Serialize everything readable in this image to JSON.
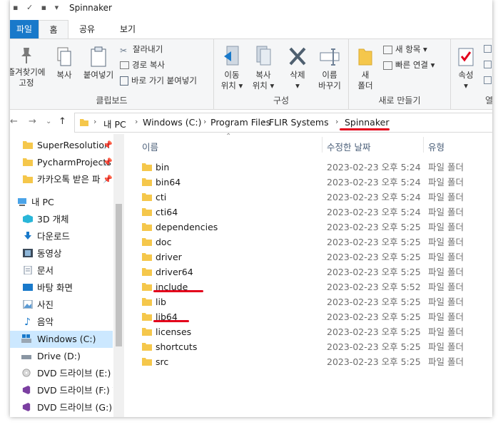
{
  "window": {
    "title": "Spinnaker"
  },
  "tabs": [
    "파일",
    "홈",
    "공유",
    "보기"
  ],
  "ribbon": {
    "clipboard": {
      "pin_label": [
        "즐겨찾기에",
        "고정"
      ],
      "copy_label": "복사",
      "paste_label": "붙여넣기",
      "cut_label": "잘라내기",
      "copy_path_label": "경로 복사",
      "paste_shortcut_label": "바로 가기 붙여넣기",
      "group_label": "클립보드"
    },
    "organize": {
      "move_label": [
        "이동",
        "위치 ▾"
      ],
      "copyto_label": [
        "복사",
        "위치 ▾"
      ],
      "delete_label": [
        "삭제",
        "▾"
      ],
      "rename_label": [
        "이름",
        "바꾸기"
      ],
      "group_label": "구성"
    },
    "new": {
      "new_folder_label": [
        "새",
        "폴더"
      ],
      "new_item_label": "새 항목 ▾",
      "easy_access_label": "빠른 연결 ▾",
      "group_label": "새로 만들기"
    },
    "open": {
      "properties_label": [
        "속성",
        "▾"
      ],
      "group_label_partial": "열"
    }
  },
  "address": {
    "crumbs": [
      "내 PC",
      "Windows (C:)",
      "Program Files",
      "FLIR Systems",
      "Spinnaker"
    ]
  },
  "sidebar": {
    "items": [
      {
        "label": "SuperResolution",
        "icon": "folder-icon",
        "pinned": true
      },
      {
        "label": "PycharmProjects",
        "icon": "folder-icon",
        "pinned": true
      },
      {
        "label": "카카오톡 받은 파",
        "icon": "folder-icon",
        "pinned": true
      },
      {
        "label": "내 PC",
        "icon": "pc-icon"
      },
      {
        "label": "3D 개체",
        "icon": "3d-objects-icon"
      },
      {
        "label": "다운로드",
        "icon": "download-icon"
      },
      {
        "label": "동영상",
        "icon": "video-icon"
      },
      {
        "label": "문서",
        "icon": "document-icon"
      },
      {
        "label": "바탕 화면",
        "icon": "desktop-icon"
      },
      {
        "label": "사진",
        "icon": "pictures-icon"
      },
      {
        "label": "음악",
        "icon": "music-icon"
      },
      {
        "label": "Windows (C:)",
        "icon": "drive-c-icon",
        "selected": true
      },
      {
        "label": "Drive (D:)",
        "icon": "drive-icon"
      },
      {
        "label": "DVD 드라이브 (E:) V",
        "icon": "dvd-icon"
      },
      {
        "label": "DVD 드라이브 (F:) V",
        "icon": "vs-dvd-icon"
      },
      {
        "label": "DVD 드라이브 (G:) V",
        "icon": "vs-dvd-icon"
      }
    ]
  },
  "columns": {
    "name": "이름",
    "date": "수정한 날짜",
    "type": "유형"
  },
  "files": [
    {
      "name": "bin",
      "date": "2023-02-23 오후 5:24",
      "type": "파일 폴더"
    },
    {
      "name": "bin64",
      "date": "2023-02-23 오후 5:24",
      "type": "파일 폴더"
    },
    {
      "name": "cti",
      "date": "2023-02-23 오후 5:24",
      "type": "파일 폴더"
    },
    {
      "name": "cti64",
      "date": "2023-02-23 오후 5:24",
      "type": "파일 폴더"
    },
    {
      "name": "dependencies",
      "date": "2023-02-23 오후 5:25",
      "type": "파일 폴더"
    },
    {
      "name": "doc",
      "date": "2023-02-23 오후 5:25",
      "type": "파일 폴더"
    },
    {
      "name": "driver",
      "date": "2023-02-23 오후 5:25",
      "type": "파일 폴더"
    },
    {
      "name": "driver64",
      "date": "2023-02-23 오후 5:25",
      "type": "파일 폴더"
    },
    {
      "name": "include",
      "date": "2023-02-23 오후 5:52",
      "type": "파일 폴더"
    },
    {
      "name": "lib",
      "date": "2023-02-23 오후 5:25",
      "type": "파일 폴더"
    },
    {
      "name": "lib64",
      "date": "2023-02-23 오후 5:25",
      "type": "파일 폴더"
    },
    {
      "name": "licenses",
      "date": "2023-02-23 오후 5:25",
      "type": "파일 폴더"
    },
    {
      "name": "shortcuts",
      "date": "2023-02-23 오후 5:25",
      "type": "파일 폴더"
    },
    {
      "name": "src",
      "date": "2023-02-23 오후 5:25",
      "type": "파일 폴더"
    }
  ],
  "colors": {
    "accent": "#1979ca",
    "folder": "#f5c74b",
    "selection": "#cce8ff",
    "annotation": "#e3001b"
  }
}
